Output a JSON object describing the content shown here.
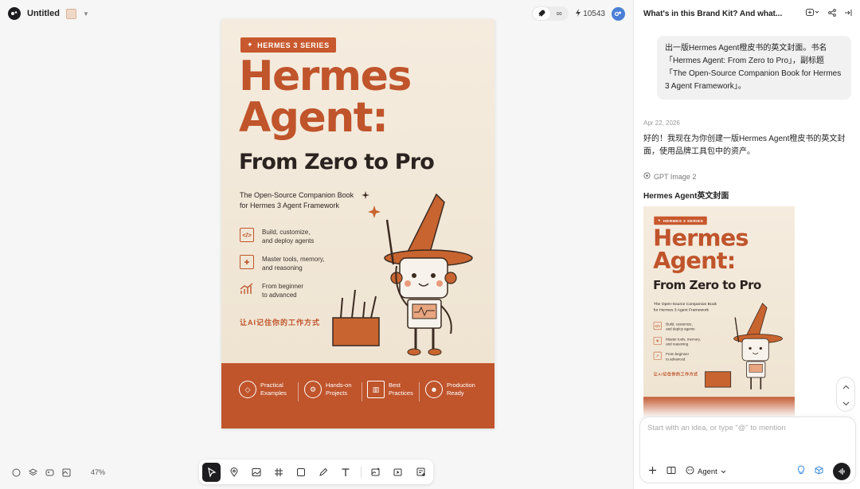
{
  "app": {
    "title": "Untitled",
    "zoom": "47%",
    "credits": "10543",
    "view_toggle": [
      "rocket-icon",
      "infinity-icon"
    ]
  },
  "book": {
    "series": "HERMES 3 SERIES",
    "title_line1": "Hermes",
    "title_line2": "Agent:",
    "subtitle": "From Zero to Pro",
    "desc_line1": "The Open-Source Companion Book",
    "desc_line2": "for Hermes 3 Agent Framework",
    "features": [
      {
        "line1": "Build, customize,",
        "line2": "and deploy agents",
        "icon": "code-icon"
      },
      {
        "line1": "Master tools, memory,",
        "line2": "and reasoning",
        "icon": "puzzle-icon"
      },
      {
        "line1": "From beginner",
        "line2": "to advanced",
        "icon": "chart-icon"
      }
    ],
    "tagline": "让AI记住你的工作方式",
    "bottom": [
      {
        "line1": "Practical",
        "line2": "Examples",
        "icon": "cube-icon"
      },
      {
        "line1": "Hands-on",
        "line2": "Projects",
        "icon": "gear-icon"
      },
      {
        "line1": "Best",
        "line2": "Practices",
        "icon": "book-icon"
      },
      {
        "line1": "Production",
        "line2": "Ready",
        "icon": "people-icon"
      }
    ]
  },
  "toolbar": {
    "tools": [
      "select-tool",
      "pin-tool",
      "image-tool",
      "frame-tool",
      "rectangle-tool",
      "pen-tool",
      "text-tool",
      "image-edit-tool",
      "video-tool",
      "add-frame-tool"
    ]
  },
  "panel": {
    "title": "What's in this Brand Kit? And what...",
    "user_message": "出一版Hermes Agent橙皮书的英文封面。书名「Hermes Agent: From Zero to Pro」，副标题「The Open-Source Companion Book for Hermes 3 Agent Framework」。",
    "date": "Apr 22, 2026",
    "assistant_message": "好的！我现在为你创建一版Hermes Agent橙皮书的英文封面，使用品牌工具包中的资产。",
    "model": "GPT Image 2",
    "image_title": "Hermes Agent英文封面",
    "composer_placeholder": "Start with an idea, or type \"@\" to mention",
    "agent_label": "Agent"
  },
  "colors": {
    "accent": "#c0542b",
    "cream": "#f2e8d9",
    "dark": "#1d1d1f"
  }
}
